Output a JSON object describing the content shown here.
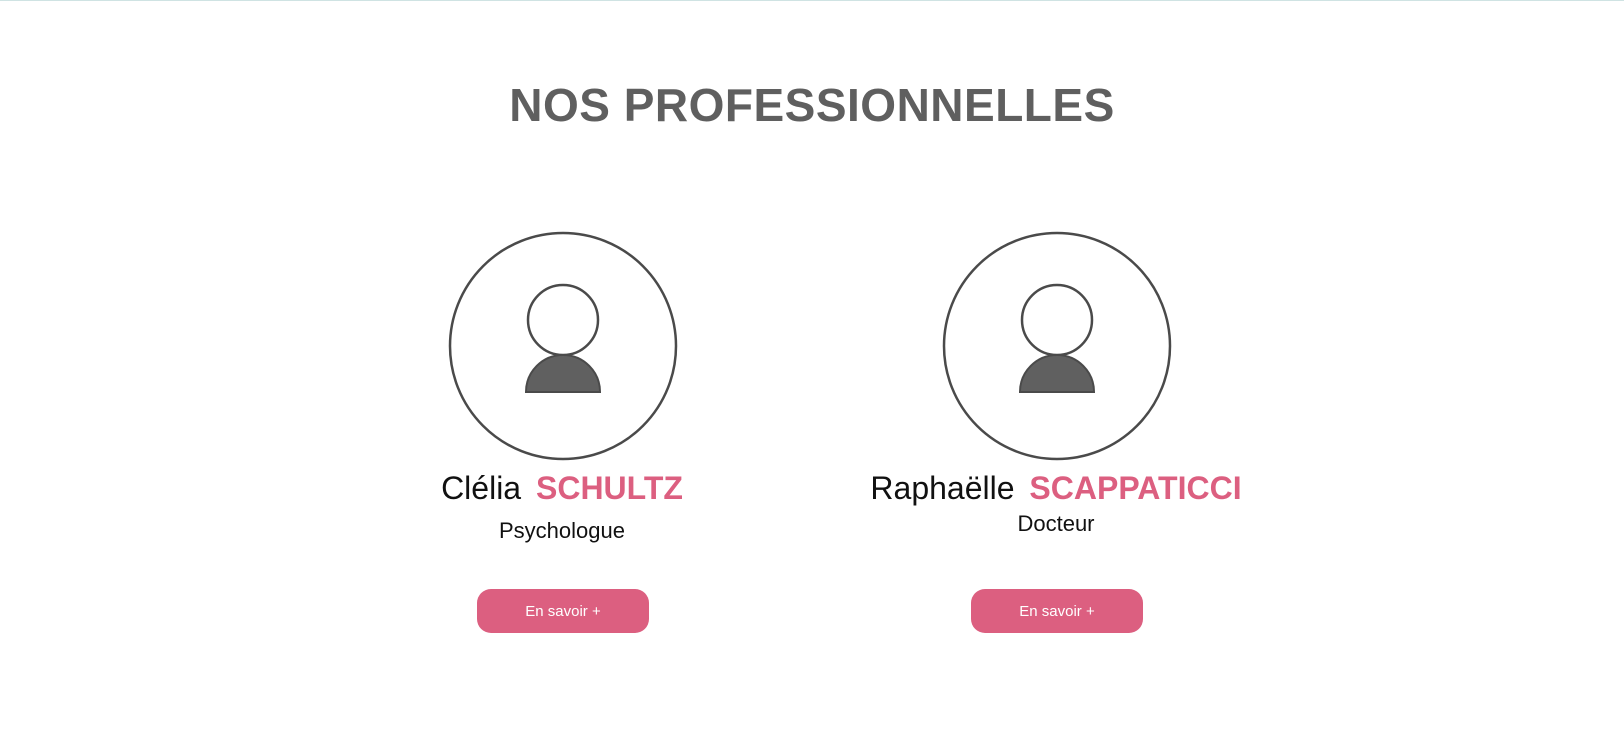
{
  "section": {
    "title": "NOS PROFESSIONNELLES"
  },
  "theme": {
    "accent": "#dc5f80",
    "title_color": "#5f5f5f",
    "icon_stroke": "#4a4a4a",
    "icon_fill": "#606060"
  },
  "professionals": [
    {
      "first_name": "Clélia",
      "last_name": "SCHULTZ",
      "role": "Psychologue",
      "button_label": "En savoir +",
      "avatar_icon": "user-placeholder-icon"
    },
    {
      "first_name": "Raphaëlle",
      "last_name": "SCAPPATICCI",
      "role": "Docteur",
      "button_label": "En savoir +",
      "avatar_icon": "user-placeholder-icon"
    }
  ]
}
